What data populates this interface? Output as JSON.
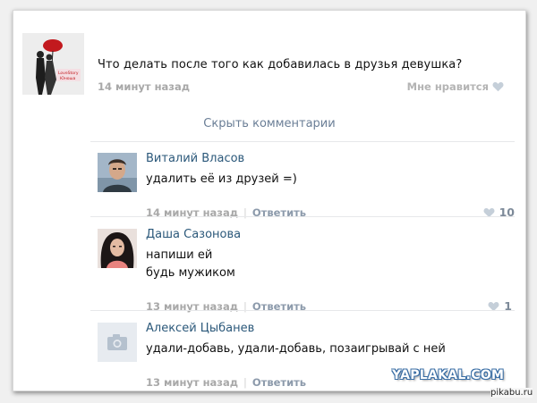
{
  "post": {
    "text": "Что делать после того как добавилась в друзья девушка?",
    "time": "14 минут назад",
    "like_label": "Мне нравится",
    "thumb_caption": "LoveStory Юноша"
  },
  "hide_comments": "Скрыть комментарии",
  "comments": [
    {
      "name": "Виталий Власов",
      "text": "удалить её из друзей =)",
      "time": "14 минут назад",
      "reply": "Ответить",
      "likes": "10",
      "separator": "|"
    },
    {
      "name": "Даша Сазонова",
      "text": "напиши ей\nбудь мужиком",
      "time": "13 минут назад",
      "reply": "Ответить",
      "likes": "1",
      "separator": "|"
    },
    {
      "name": "Алексей Цыбанев",
      "text": "удали-добавь, удали-добавь, позаигрывай с ней",
      "time": "13 минут назад",
      "reply": "Ответить",
      "likes": "",
      "separator": "|"
    }
  ],
  "watermark": "YAPLAKAL.COM",
  "source": "pikabu.ru",
  "colors": {
    "name_link": "#2b587a",
    "reply_link": "#8c9aab",
    "meta_gray": "#a8a8a8",
    "heart": "#c5cfd9"
  },
  "icons": {
    "like": "heart-icon",
    "no_photo": "camera-icon"
  }
}
